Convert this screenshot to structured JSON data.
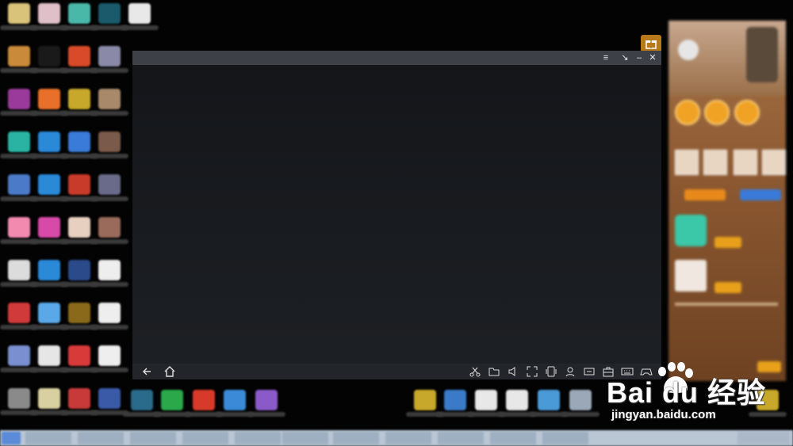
{
  "watermark": {
    "brand": "Bai du 经验",
    "url": "jingyan.baidu.com"
  },
  "emulator": {
    "title_buttons": [
      "menu-icon",
      "restore-icon",
      "minimize-icon",
      "close-icon"
    ],
    "title_glyphs": {
      "menu": "≡",
      "restore": "↘",
      "minimize": "–",
      "close": "✕"
    },
    "bottom_left": [
      "back-icon",
      "home-icon"
    ],
    "bottom_right": [
      "scissors-icon",
      "folder-icon",
      "volume-icon",
      "fullscreen-icon",
      "shake-icon",
      "location-icon",
      "apk-icon",
      "toolbox-icon",
      "keyboard-icon",
      "gamepad-icon"
    ]
  },
  "colors": {
    "window_title": "#3d4147",
    "window_bg": "#171a1e",
    "accent": "#f0a224"
  }
}
